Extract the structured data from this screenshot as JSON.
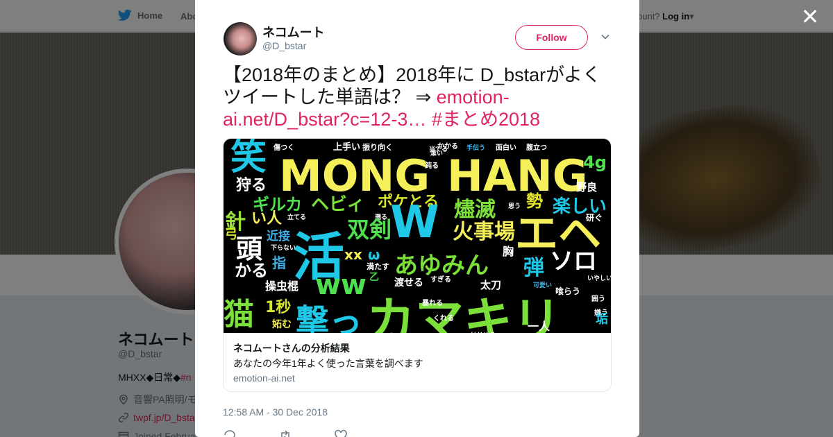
{
  "nav": {
    "home_label": "Home",
    "about_label": "Abo",
    "account_prompt": "ccount?",
    "login_label": "Log in"
  },
  "profile": {
    "name": "ネコムート",
    "handle": "@D_bstar",
    "bio_prefix": "MHXX◆日常◆",
    "bio_tag": "#n",
    "location": "音響PA照明/モ",
    "url": "twpf.jp/D_bsta",
    "joined": "Joined Februa"
  },
  "tweet": {
    "author_name": "ネコムート",
    "author_handle": "@D_bstar",
    "follow_label": "Follow",
    "text_main": "【2018年のまとめ】2018年に D_bstarがよくツイートした単語は？ ⇒ ",
    "text_link": "emotion-ai.net/D_bstar?c=12-3…",
    "text_hashtag": "#まとめ2018",
    "timestamp": "12:58 AM - 30 Dec 2018"
  },
  "card": {
    "title": "ネコムートさんの分析結果",
    "description": "あなたの今年1年よく使った言葉を調べます",
    "domain": "emotion-ai.net"
  },
  "wordcloud": [
    {
      "t": "笑",
      "c": "#1ec8e6"
    },
    {
      "t": "上手い",
      "c": "#ffffff"
    },
    {
      "t": "振り向く",
      "c": "#ffffff"
    },
    {
      "t": "傷つく",
      "c": "#ffffff"
    },
    {
      "t": "当てる",
      "c": "#ffffff"
    },
    {
      "t": "かかる",
      "c": "#ffffff"
    },
    {
      "t": "手伝う",
      "c": "#3fb0e8"
    },
    {
      "t": "面白い",
      "c": "#ffffff"
    },
    {
      "t": "腹立つ",
      "c": "#ffffff"
    },
    {
      "t": "鈍る",
      "c": "#ffffff"
    },
    {
      "t": "潔い",
      "c": "#ffffff"
    },
    {
      "t": "MONG",
      "c": "#f5ef5a"
    },
    {
      "t": "HANG",
      "c": "#f5ef5a"
    },
    {
      "t": "4g",
      "c": "#4ee04e"
    },
    {
      "t": "狩る",
      "c": "#ffffff"
    },
    {
      "t": "野良",
      "c": "#ffffff"
    },
    {
      "t": "ギルカ",
      "c": "#4ee04e"
    },
    {
      "t": "ヘビィ",
      "c": "#7be03a"
    },
    {
      "t": "ポケとる",
      "c": "#d8e62a"
    },
    {
      "t": "燼滅",
      "c": "#7be03a"
    },
    {
      "t": "勢",
      "c": "#e6e62a"
    },
    {
      "t": "楽しい",
      "c": "#1ec8e6"
    },
    {
      "t": "針",
      "c": "#9be03a"
    },
    {
      "t": "い人",
      "c": "#f5ef5a"
    },
    {
      "t": "立てる",
      "c": "#ffffff"
    },
    {
      "t": "遡る",
      "c": "#ffffff"
    },
    {
      "t": "思う",
      "c": "#ffffff"
    },
    {
      "t": "研ぐ",
      "c": "#ffffff"
    },
    {
      "t": "弓",
      "c": "#d8e62a"
    },
    {
      "t": "近接",
      "c": "#3fb0e8"
    },
    {
      "t": "活",
      "c": "#1ec8e6"
    },
    {
      "t": "双剣",
      "c": "#4ee04e"
    },
    {
      "t": "W",
      "c": "#1ec8e6"
    },
    {
      "t": "火事場",
      "c": "#f5ef5a"
    },
    {
      "t": "エヘ",
      "c": "#f5ef5a"
    },
    {
      "t": "頭",
      "c": "#ffffff"
    },
    {
      "t": "下らない",
      "c": "#ffffff"
    },
    {
      "t": "xx",
      "c": "#f5ef5a"
    },
    {
      "t": "ω",
      "c": "#1ec8e6"
    },
    {
      "t": "胸",
      "c": "#ffffff"
    },
    {
      "t": "かる",
      "c": "#ffffff"
    },
    {
      "t": "指",
      "c": "#3fb0e8"
    },
    {
      "t": "満たす",
      "c": "#ffffff"
    },
    {
      "t": "乙",
      "c": "#4ee04e"
    },
    {
      "t": "あゆみん",
      "c": "#7be03a"
    },
    {
      "t": "ソロ",
      "c": "#ffffff"
    },
    {
      "t": "弾",
      "c": "#1ec8e6"
    },
    {
      "t": "操虫棍",
      "c": "#ffffff"
    },
    {
      "t": "ww",
      "c": "#4ee04e"
    },
    {
      "t": "渡せる",
      "c": "#ffffff"
    },
    {
      "t": "すぎる",
      "c": "#ffffff"
    },
    {
      "t": "太刀",
      "c": "#ffffff"
    },
    {
      "t": "喰らう",
      "c": "#ffffff"
    },
    {
      "t": "可愛い",
      "c": "#3fb0e8"
    },
    {
      "t": "いやしい",
      "c": "#ffffff"
    },
    {
      "t": "猫",
      "c": "#7be03a"
    },
    {
      "t": "1秒",
      "c": "#d8e62a"
    },
    {
      "t": "撃っ",
      "c": "#1ec8e6"
    },
    {
      "t": "カマキリ",
      "c": "#7be03a"
    },
    {
      "t": "暴れる",
      "c": "#ffffff"
    },
    {
      "t": "囲う",
      "c": "#ffffff"
    },
    {
      "t": "嫌う",
      "c": "#ffffff"
    },
    {
      "t": "妬む",
      "c": "#f5ef5a"
    },
    {
      "t": "くれる",
      "c": "#ffffff"
    },
    {
      "t": "一人",
      "c": "#ffffff"
    },
    {
      "t": "垢",
      "c": "#1ec8e6"
    },
    {
      "t": "はじめる",
      "c": "#ffffff"
    }
  ]
}
